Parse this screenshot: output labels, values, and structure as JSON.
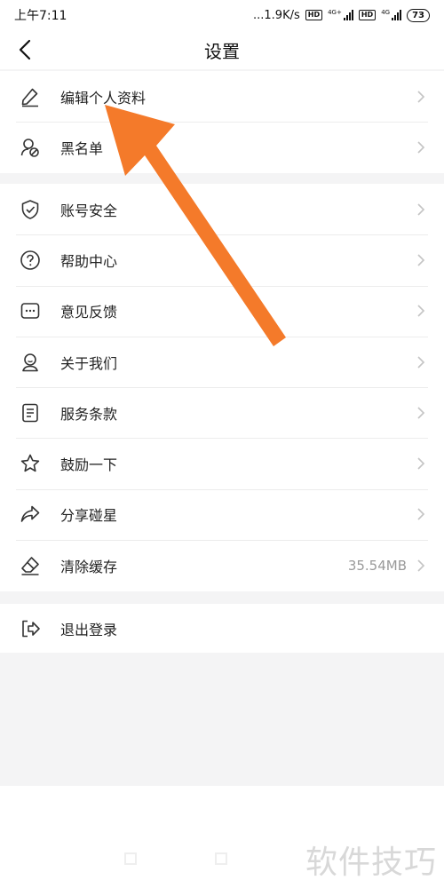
{
  "status_bar": {
    "time": "上午7:11",
    "speed": "...1.9K/s",
    "hd1": "HD",
    "net1": "4G+",
    "hd2": "HD",
    "net2": "4G",
    "battery": "73"
  },
  "nav": {
    "title": "设置",
    "back_icon": "chevron-left-icon"
  },
  "group1": [
    {
      "label": "编辑个人资料",
      "icon": "pencil-icon"
    },
    {
      "label": "黑名单",
      "icon": "user-block-icon"
    }
  ],
  "group2": [
    {
      "label": "账号安全",
      "icon": "shield-check-icon"
    },
    {
      "label": "帮助中心",
      "icon": "question-circle-icon"
    },
    {
      "label": "意见反馈",
      "icon": "chat-dots-icon"
    },
    {
      "label": "关于我们",
      "icon": "person-icon"
    },
    {
      "label": "服务条款",
      "icon": "document-icon"
    },
    {
      "label": "鼓励一下",
      "icon": "star-icon"
    },
    {
      "label": "分享碰星",
      "icon": "share-icon"
    },
    {
      "label": "清除缓存",
      "icon": "eraser-icon",
      "value": "35.54MB"
    }
  ],
  "group3": [
    {
      "label": "退出登录",
      "icon": "logout-icon"
    }
  ],
  "watermark": "软件技巧",
  "colors": {
    "annotation_arrow": "#f47a2a",
    "separator": "#f4f4f5",
    "chevron": "#c4c4c4"
  }
}
